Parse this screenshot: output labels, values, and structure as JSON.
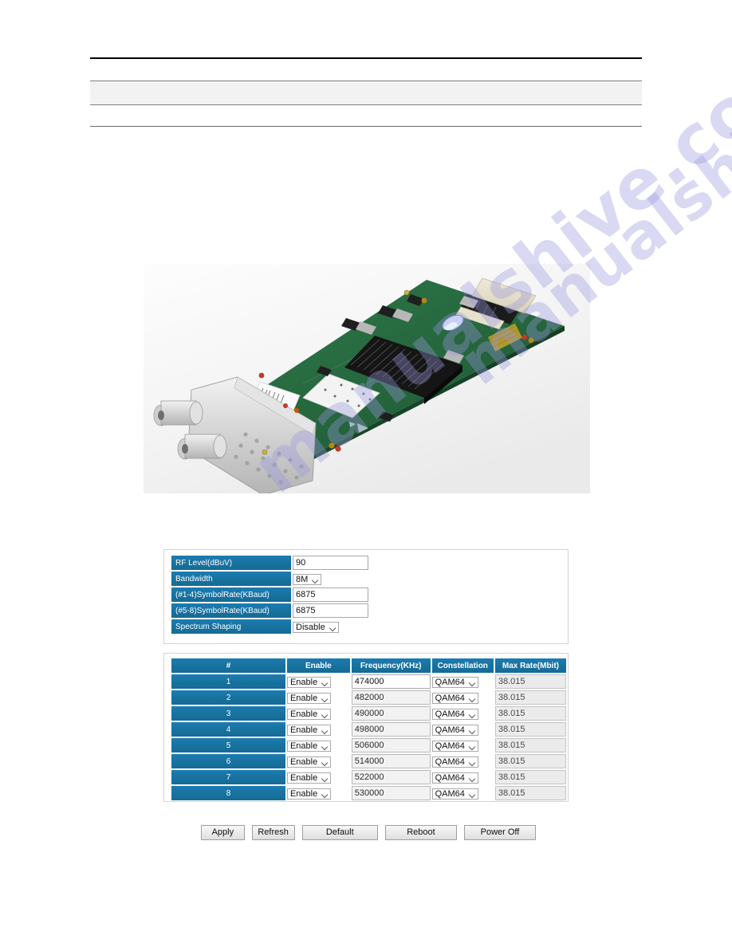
{
  "document": {
    "header_band_text": "",
    "watermark": {
      "line1": "manualshive.com",
      "line2": "manualshive.com"
    }
  },
  "photo": {
    "caption": "",
    "alt_name": "rf-modulator-board-photo"
  },
  "settings_panel": {
    "rows": [
      {
        "label": "RF Level(dBuV)",
        "control": "text",
        "value": "90"
      },
      {
        "label": "Bandwidth",
        "control": "select",
        "value": "8M"
      },
      {
        "label": "(#1-4)SymbolRate(KBaud)",
        "control": "text",
        "value": "6875"
      },
      {
        "label": "(#5-8)SymbolRate(KBaud)",
        "control": "text",
        "value": "6875"
      },
      {
        "label": "Spectrum Shaping",
        "control": "select",
        "value": "Disable"
      }
    ]
  },
  "channel_table": {
    "headers": [
      "#",
      "Enable",
      "Frequency(KHz)",
      "Constellation",
      "Max Rate(Mbit)"
    ],
    "rows": [
      {
        "num": "1",
        "enable": "Enable",
        "frequency": "474000",
        "constellation": "QAM64",
        "max_rate": "38.015"
      },
      {
        "num": "2",
        "enable": "Enable",
        "frequency": "482000",
        "constellation": "QAM64",
        "max_rate": "38.015"
      },
      {
        "num": "3",
        "enable": "Enable",
        "frequency": "490000",
        "constellation": "QAM64",
        "max_rate": "38.015"
      },
      {
        "num": "4",
        "enable": "Enable",
        "frequency": "498000",
        "constellation": "QAM64",
        "max_rate": "38.015"
      },
      {
        "num": "5",
        "enable": "Enable",
        "frequency": "506000",
        "constellation": "QAM64",
        "max_rate": "38.015"
      },
      {
        "num": "6",
        "enable": "Enable",
        "frequency": "514000",
        "constellation": "QAM64",
        "max_rate": "38.015"
      },
      {
        "num": "7",
        "enable": "Enable",
        "frequency": "522000",
        "constellation": "QAM64",
        "max_rate": "38.015"
      },
      {
        "num": "8",
        "enable": "Enable",
        "frequency": "530000",
        "constellation": "QAM64",
        "max_rate": "38.015"
      }
    ]
  },
  "buttons": {
    "apply": "Apply",
    "refresh": "Refresh",
    "default": "Default",
    "reboot": "Reboot",
    "power_off": "Power Off"
  },
  "colors": {
    "header_blue": "#18729f",
    "panel_border": "#d4d4d4",
    "watermark": "#9a97e0"
  }
}
